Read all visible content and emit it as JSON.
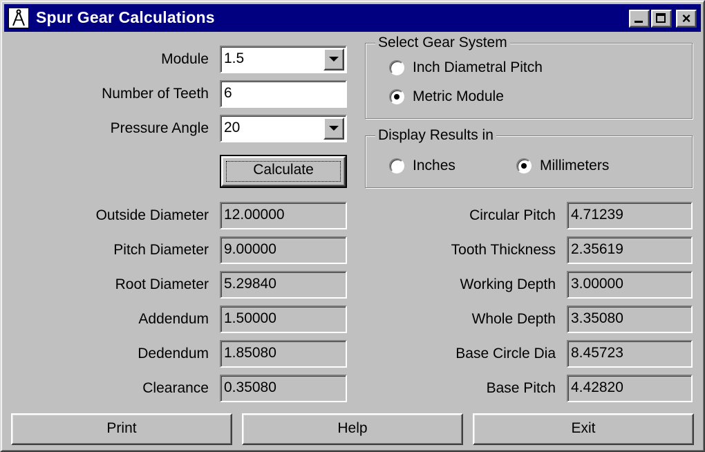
{
  "window": {
    "title": "Spur Gear Calculations",
    "icon": "compass-icon",
    "controls": {
      "minimize": "minimize-icon",
      "maximize": "maximize-icon",
      "close": "×"
    }
  },
  "inputs": {
    "module": {
      "label": "Module",
      "value": "1.5"
    },
    "teeth": {
      "label": "Number of Teeth",
      "value": "6"
    },
    "pressure_angle": {
      "label": "Pressure Angle",
      "value": "20"
    },
    "calculate_label": "Calculate"
  },
  "gear_system": {
    "title": "Select Gear System",
    "options": [
      {
        "label": "Inch Diametral Pitch",
        "checked": false
      },
      {
        "label": "Metric Module",
        "checked": true
      }
    ]
  },
  "display_units": {
    "title": "Display Results in",
    "options": [
      {
        "label": "Inches",
        "checked": false
      },
      {
        "label": "Millimeters",
        "checked": true
      }
    ]
  },
  "results_left": [
    {
      "label": "Outside Diameter",
      "value": "12.00000"
    },
    {
      "label": "Pitch Diameter",
      "value": "9.00000"
    },
    {
      "label": "Root Diameter",
      "value": "5.29840"
    },
    {
      "label": "Addendum",
      "value": "1.50000"
    },
    {
      "label": "Dedendum",
      "value": "1.85080"
    },
    {
      "label": "Clearance",
      "value": "0.35080"
    }
  ],
  "results_right": [
    {
      "label": "Circular Pitch",
      "value": "4.71239"
    },
    {
      "label": "Tooth Thickness",
      "value": "2.35619"
    },
    {
      "label": "Working Depth",
      "value": "3.00000"
    },
    {
      "label": "Whole Depth",
      "value": "3.35080"
    },
    {
      "label": "Base Circle Dia",
      "value": "8.45723"
    },
    {
      "label": "Base Pitch",
      "value": "4.42820"
    }
  ],
  "footer": {
    "print_label": "Print",
    "help_label": "Help",
    "exit_label": "Exit"
  },
  "colors": {
    "titlebar": "#000080",
    "face": "#c0c0c0"
  }
}
